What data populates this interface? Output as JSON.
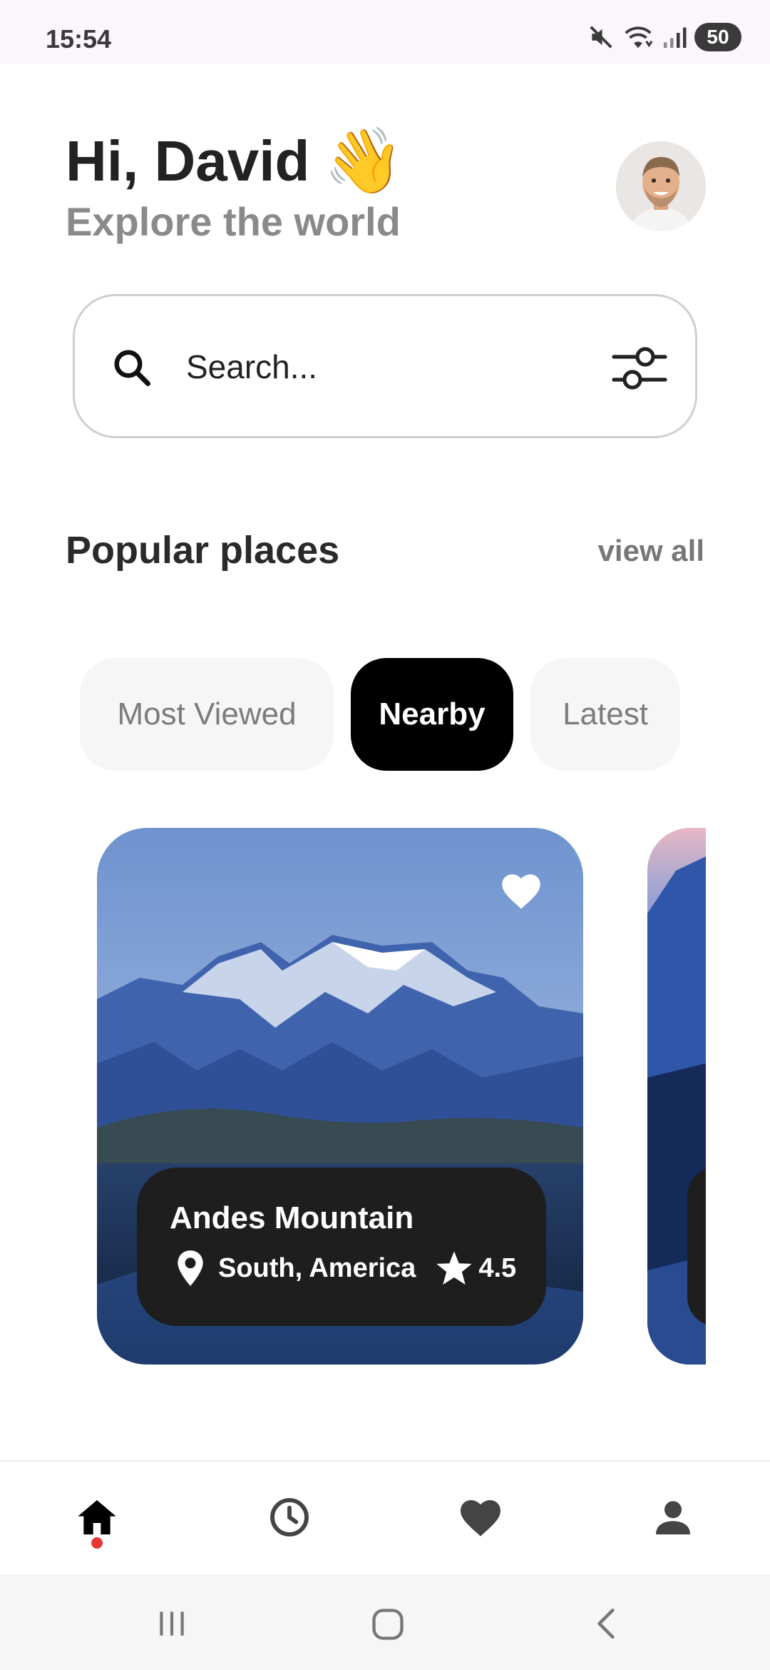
{
  "status_bar": {
    "time": "15:54",
    "battery": "50",
    "icons": [
      "mute-icon",
      "wifi-icon",
      "signal-icon",
      "battery-icon"
    ]
  },
  "header": {
    "greeting": "Hi, David",
    "emoji": "👋",
    "subtitle": "Explore the world"
  },
  "search": {
    "placeholder": "Search..."
  },
  "section": {
    "title": "Popular places",
    "view_all": "view all"
  },
  "chips": [
    {
      "label": "Most Viewed",
      "active": false
    },
    {
      "label": "Nearby",
      "active": true
    },
    {
      "label": "Latest",
      "active": false
    }
  ],
  "cards": [
    {
      "name": "Andes Mountain",
      "location": "South, America",
      "rating": "4.5",
      "favorite": true
    }
  ],
  "bottom_nav": {
    "items": [
      "home",
      "history",
      "favorites",
      "profile"
    ],
    "active": "home",
    "accent": "#e53935"
  },
  "colors": {
    "chip_active_bg": "#000000",
    "info_panel_bg": "#1e1e1e",
    "status_bar_bg": "#fbf5fc"
  }
}
